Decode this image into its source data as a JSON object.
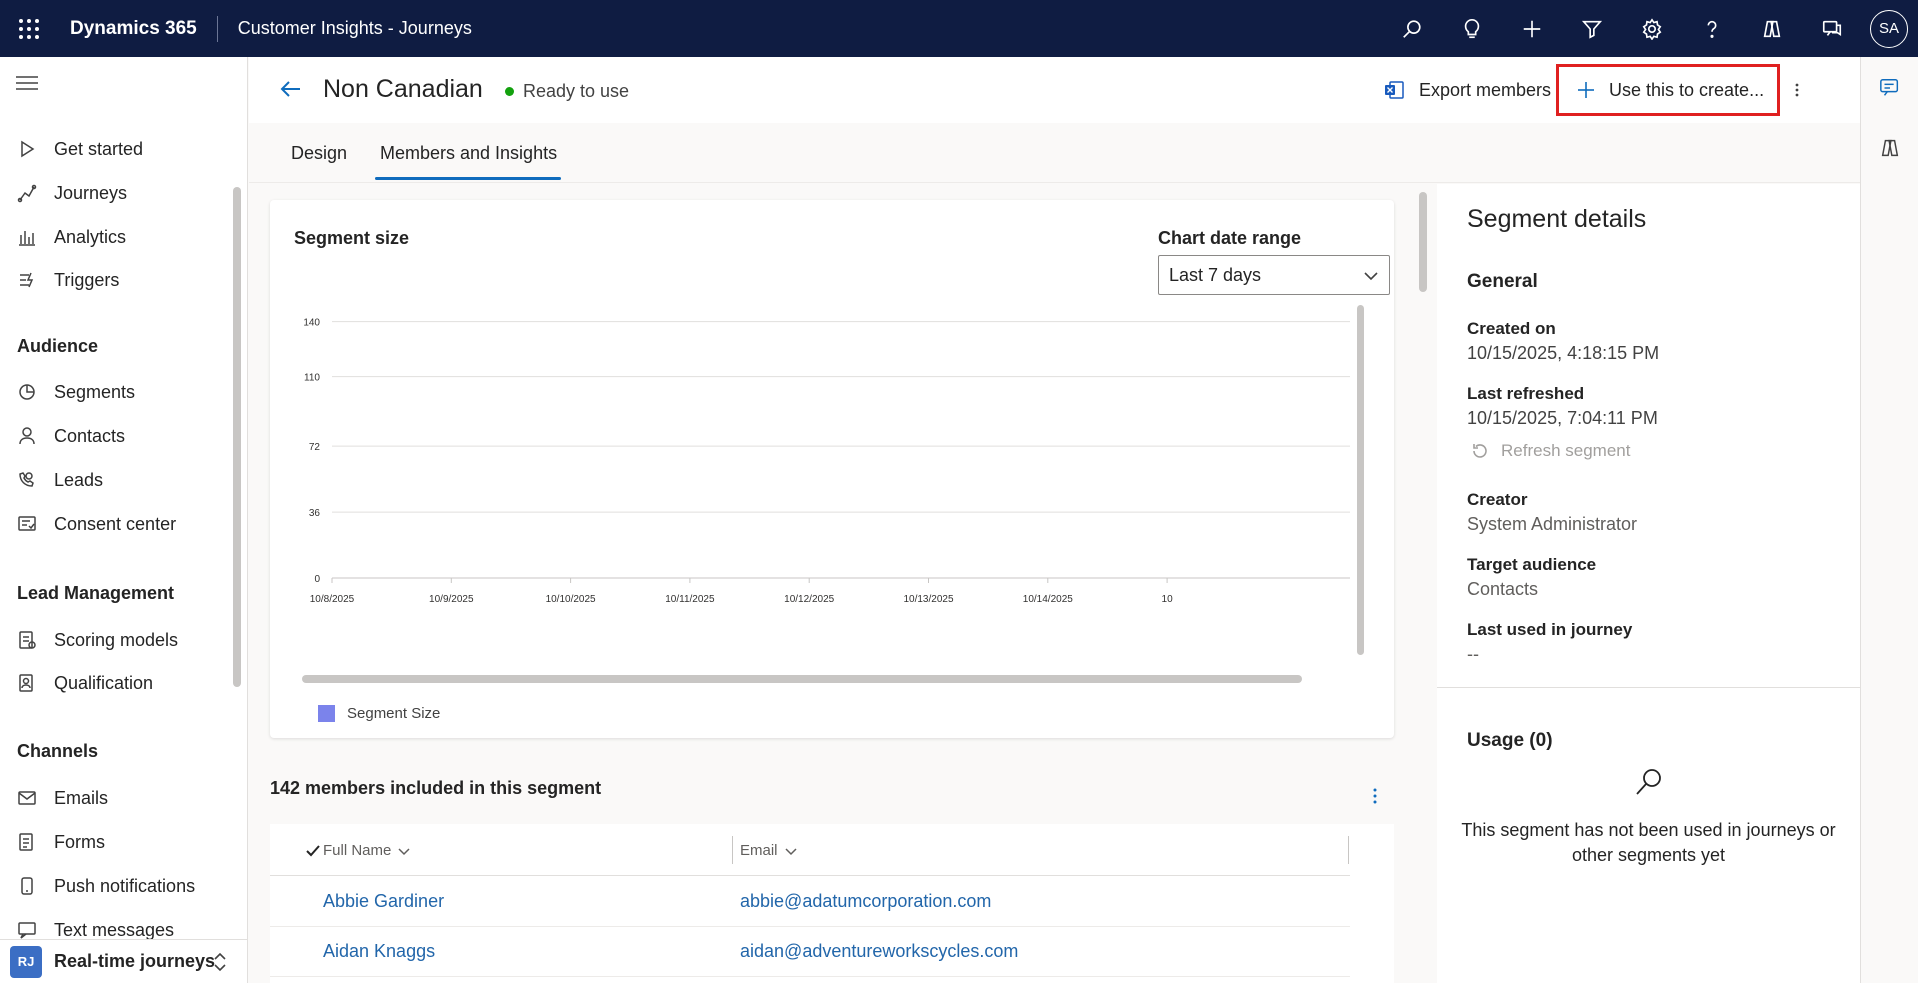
{
  "topbar": {
    "brand": "Dynamics 365",
    "app_name": "Customer Insights - Journeys",
    "icons": [
      "search-icon",
      "lightbulb-icon",
      "plus-icon",
      "filter-icon",
      "gear-icon",
      "help-icon",
      "copilot-icon",
      "chat-icon"
    ],
    "avatar_initials": "SA"
  },
  "nav": {
    "items_top": [
      {
        "label": "Get started",
        "icon": "play-icon"
      },
      {
        "label": "Journeys",
        "icon": "journey-icon"
      },
      {
        "label": "Analytics",
        "icon": "analytics-icon"
      },
      {
        "label": "Triggers",
        "icon": "trigger-icon"
      }
    ],
    "section_audience": "Audience",
    "items_audience": [
      {
        "label": "Segments",
        "icon": "segment-icon"
      },
      {
        "label": "Contacts",
        "icon": "person-icon"
      },
      {
        "label": "Leads",
        "icon": "phone-person-icon"
      },
      {
        "label": "Consent center",
        "icon": "consent-icon"
      }
    ],
    "section_lead": "Lead Management",
    "items_lead": [
      {
        "label": "Scoring models",
        "icon": "scoring-icon"
      },
      {
        "label": "Qualification",
        "icon": "qualification-icon"
      }
    ],
    "section_channels": "Channels",
    "items_channels": [
      {
        "label": "Emails",
        "icon": "mail-icon"
      },
      {
        "label": "Forms",
        "icon": "form-icon"
      },
      {
        "label": "Push notifications",
        "icon": "mobile-icon"
      },
      {
        "label": "Text messages",
        "icon": "sms-icon"
      }
    ],
    "area": {
      "initials": "RJ",
      "label": "Real-time journeys"
    }
  },
  "header": {
    "title": "Non Canadian",
    "status": "Ready to use",
    "status_color": "#13a10e",
    "export_label": "Export members",
    "use_create_label": "Use this to create..."
  },
  "tabs": [
    {
      "label": "Design",
      "active": false
    },
    {
      "label": "Members and Insights",
      "active": true
    }
  ],
  "chart": {
    "title": "Segment size",
    "range_label": "Chart date range",
    "range_value": "Last 7 days",
    "legend": "Segment Size",
    "legend_color": "#7b83eb"
  },
  "chart_data": {
    "type": "bar",
    "title": "Segment size",
    "categories": [
      "10/8/2025",
      "10/9/2025",
      "10/10/2025",
      "10/11/2025",
      "10/12/2025",
      "10/13/2025",
      "10/14/2025",
      "10"
    ],
    "y_ticks": [
      "140",
      "110",
      "72",
      "36",
      "0"
    ],
    "series": [
      {
        "name": "Segment Size",
        "values": [
          0,
          0,
          0,
          0,
          0,
          0,
          0,
          0
        ]
      }
    ],
    "ylim": [
      0,
      142
    ],
    "grid": true,
    "legend": "bottom-left"
  },
  "members": {
    "title": "142 members included in this segment",
    "columns": [
      "Full Name",
      "Email"
    ],
    "rows": [
      {
        "name": "Abbie Gardiner",
        "email": "abbie@adatumcorporation.com"
      },
      {
        "name": "Aidan Knaggs",
        "email": "aidan@adventureworkscycles.com"
      }
    ]
  },
  "details": {
    "title": "Segment details",
    "section_general": "General",
    "created_on_label": "Created on",
    "created_on": "10/15/2025, 4:18:15 PM",
    "last_refreshed_label": "Last refreshed",
    "last_refreshed": "10/15/2025, 7:04:11 PM",
    "refresh_label": "Refresh segment",
    "creator_label": "Creator",
    "creator": "System Administrator",
    "target_label": "Target audience",
    "target": "Contacts",
    "last_used_label": "Last used in journey",
    "last_used": "--",
    "usage_title": "Usage (0)",
    "usage_empty": "This segment has not been used in journeys or other segments yet"
  }
}
